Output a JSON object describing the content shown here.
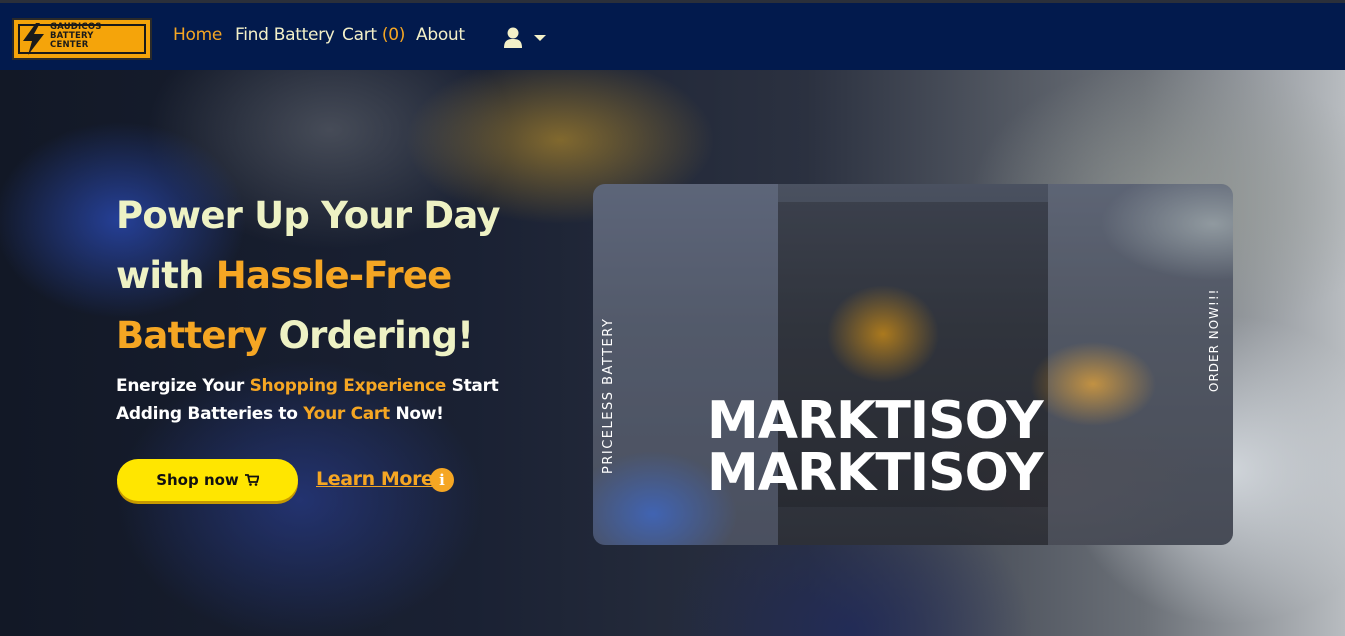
{
  "brand": {
    "logo_lines": [
      "GAUDICOS",
      "BATTERY",
      "CENTER"
    ]
  },
  "nav": {
    "home": "Home",
    "find_battery": "Find Battery",
    "cart_label": "Cart",
    "cart_count": "(0)",
    "about": "About"
  },
  "hero": {
    "title_line1": "Power Up Your Day",
    "title_with": "with",
    "title_highlight1": "Hassle-Free",
    "title_highlight2": "Battery",
    "title_end": "Ordering!",
    "sub_1": "Energize Your",
    "sub_hl1": "Shopping Experience",
    "sub_2": "Start Adding Batteries to",
    "sub_hl2": "Your Cart",
    "sub_3": "Now!",
    "shop_button": "Shop now",
    "learn_more": "Learn More"
  },
  "promo": {
    "vertical_left": "PRICELESS BATTERY",
    "vertical_right": "ORDER NOW!!!",
    "brand_line1": "MARKTISOY",
    "brand_line2": "MARKTISOY"
  },
  "colors": {
    "navbar": "#021a4d",
    "accent": "#f5a623",
    "button": "#ffe600",
    "title_text": "#eef2c4"
  },
  "icons": [
    "lightning-bolt-icon",
    "user-icon",
    "caret-down-icon",
    "cart-icon",
    "info-icon"
  ]
}
